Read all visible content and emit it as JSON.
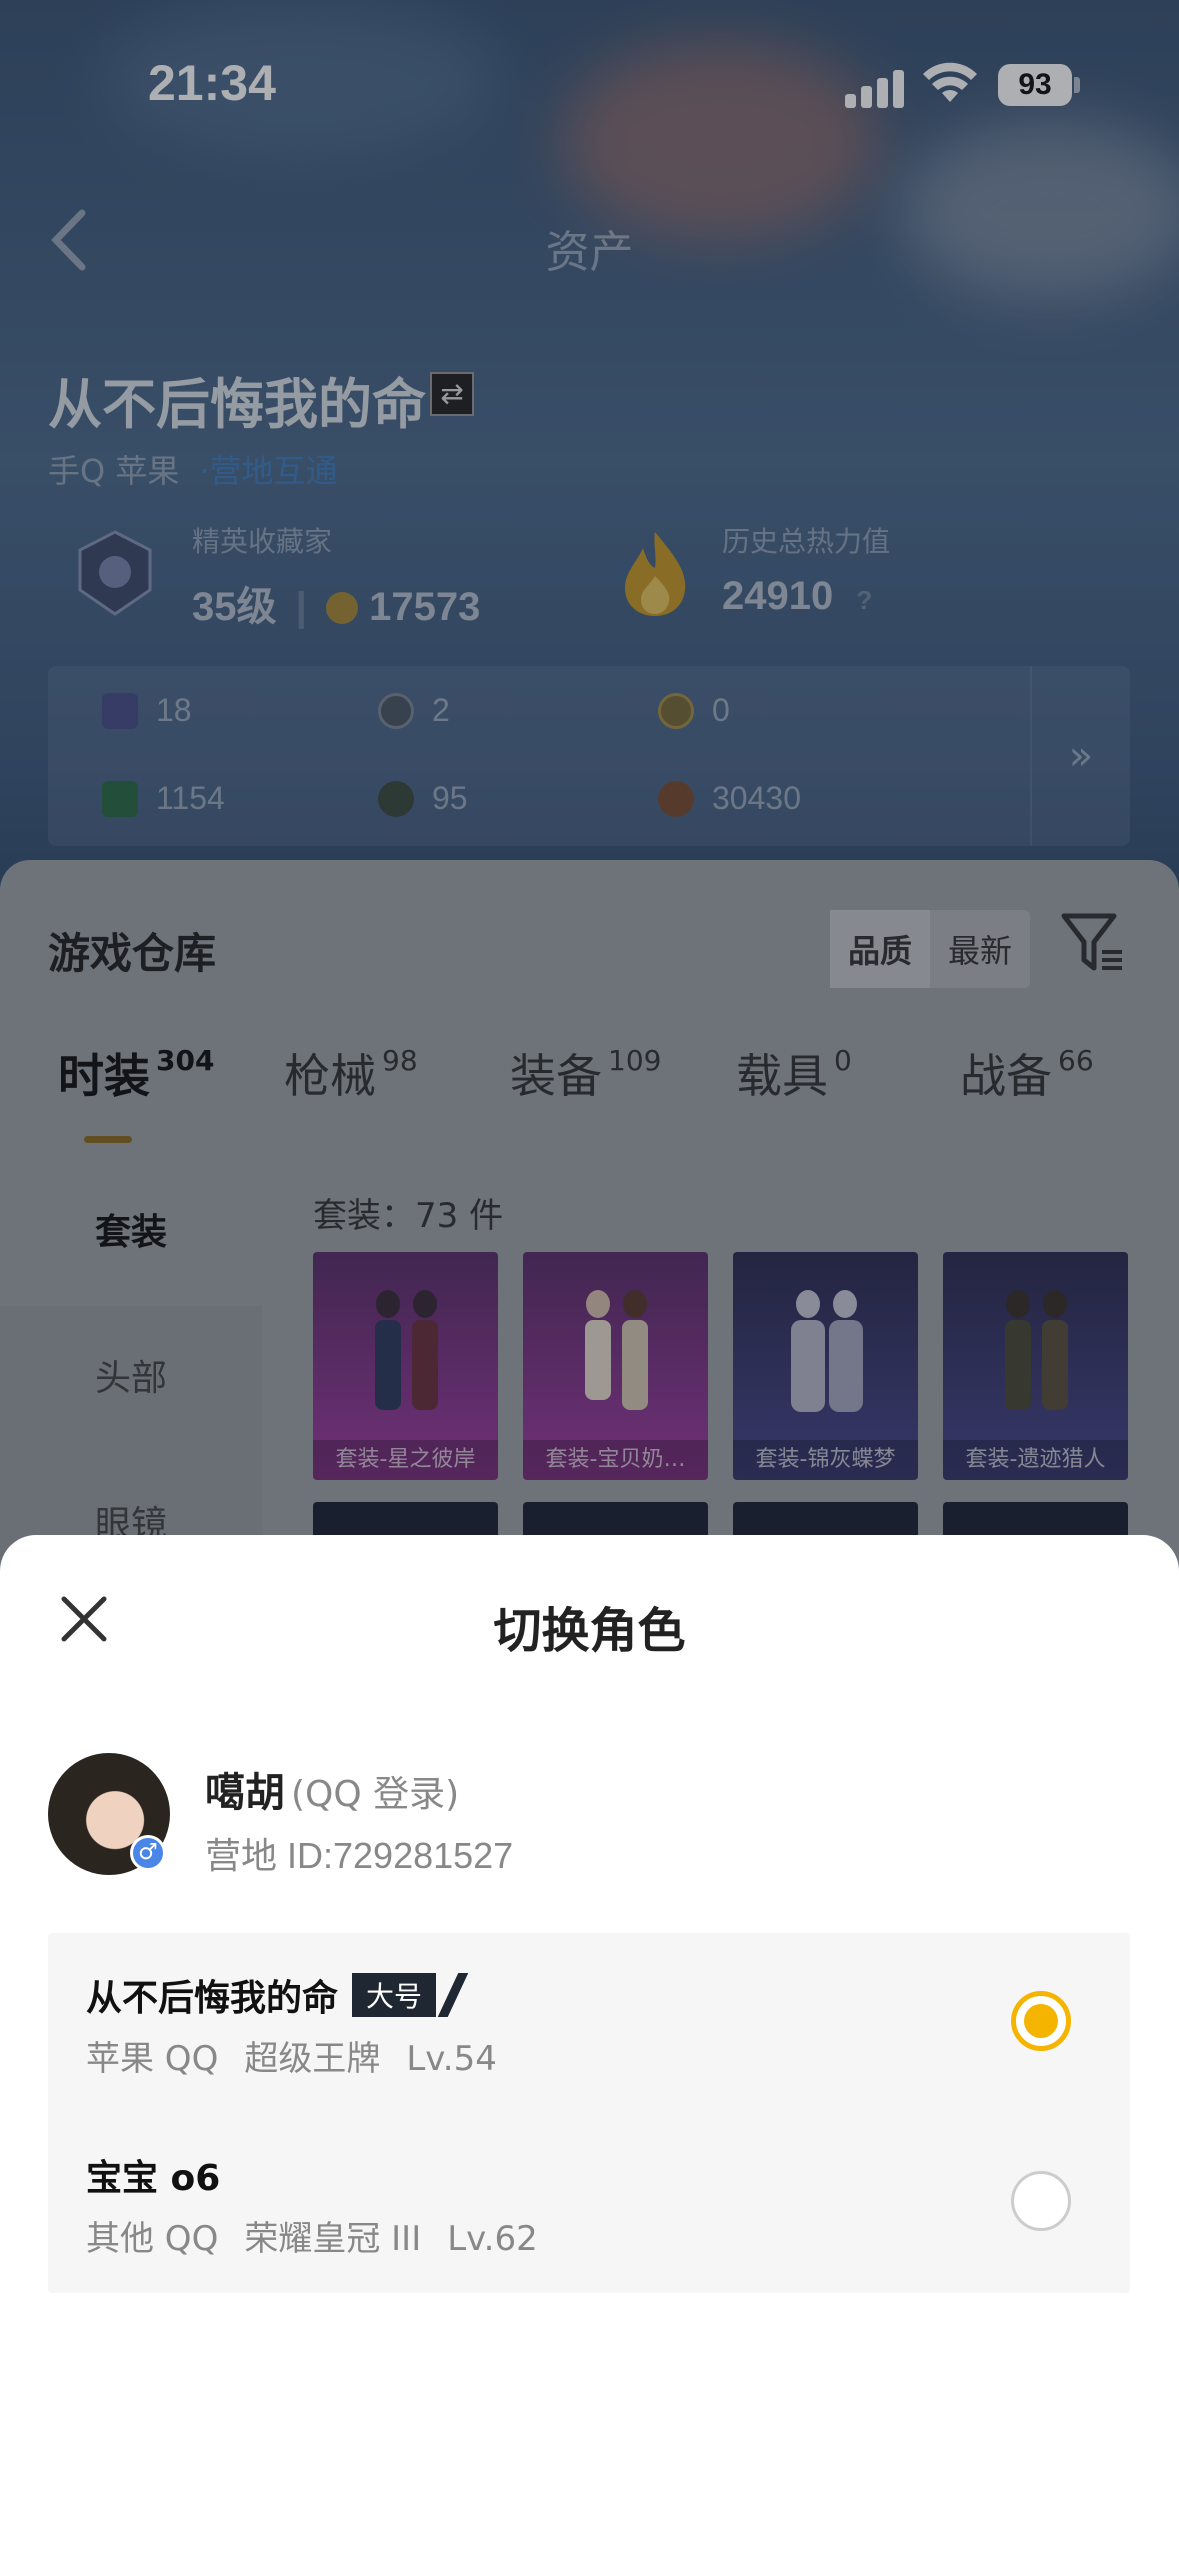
{
  "status": {
    "time": "21:34",
    "battery": "93"
  },
  "nav": {
    "title": "资产"
  },
  "player": {
    "name": "从不后悔我的命",
    "platform": "手Q 苹果",
    "link": "·营地互通"
  },
  "stats": {
    "collector_label": "精英收藏家",
    "collector_level": "35级",
    "collector_points": "17573",
    "heat_label": "历史总热力值",
    "heat_value": "24910",
    "heat_help": "?"
  },
  "resources": [
    {
      "value": "18",
      "icon": "card-icon"
    },
    {
      "value": "2",
      "icon": "coin-icon"
    },
    {
      "value": "0",
      "icon": "gold-coin-icon"
    },
    {
      "value": "1154",
      "icon": "ticket-icon"
    },
    {
      "value": "95",
      "icon": "gem-icon"
    },
    {
      "value": "30430",
      "icon": "bronze-coin-icon"
    }
  ],
  "warehouse": {
    "title": "游戏仓库",
    "sort": [
      "品质",
      "最新"
    ],
    "tabs": [
      {
        "label": "时装",
        "count": "304"
      },
      {
        "label": "枪械",
        "count": "98"
      },
      {
        "label": "装备",
        "count": "109"
      },
      {
        "label": "载具",
        "count": "0"
      },
      {
        "label": "战备",
        "count": "66"
      }
    ],
    "side": [
      "套装",
      "头部",
      "眼镜"
    ],
    "set_count": "套装：73 件",
    "items": [
      {
        "name": "套装-星之彼岸",
        "color": "#8e2f8f"
      },
      {
        "name": "套装-宝贝奶…",
        "color": "#8e2f8f"
      },
      {
        "name": "套装-锦灰蝶梦",
        "color": "#3d3c6e"
      },
      {
        "name": "套装-遗迹猎人",
        "color": "#3d3c6e"
      }
    ]
  },
  "sheet": {
    "title": "切换角色",
    "account": {
      "name": "噶胡",
      "login": "(QQ 登录)",
      "id": "营地 ID:729281527"
    },
    "roles": [
      {
        "name": "从不后悔我的命",
        "tag": "大号",
        "platform": "苹果 QQ",
        "rank": "超级王牌",
        "level": "Lv.54",
        "selected": true
      },
      {
        "name": "宝宝 o6",
        "tag": "",
        "platform": "其他 QQ",
        "rank": "荣耀皇冠 III",
        "level": "Lv.62",
        "selected": false
      }
    ]
  }
}
